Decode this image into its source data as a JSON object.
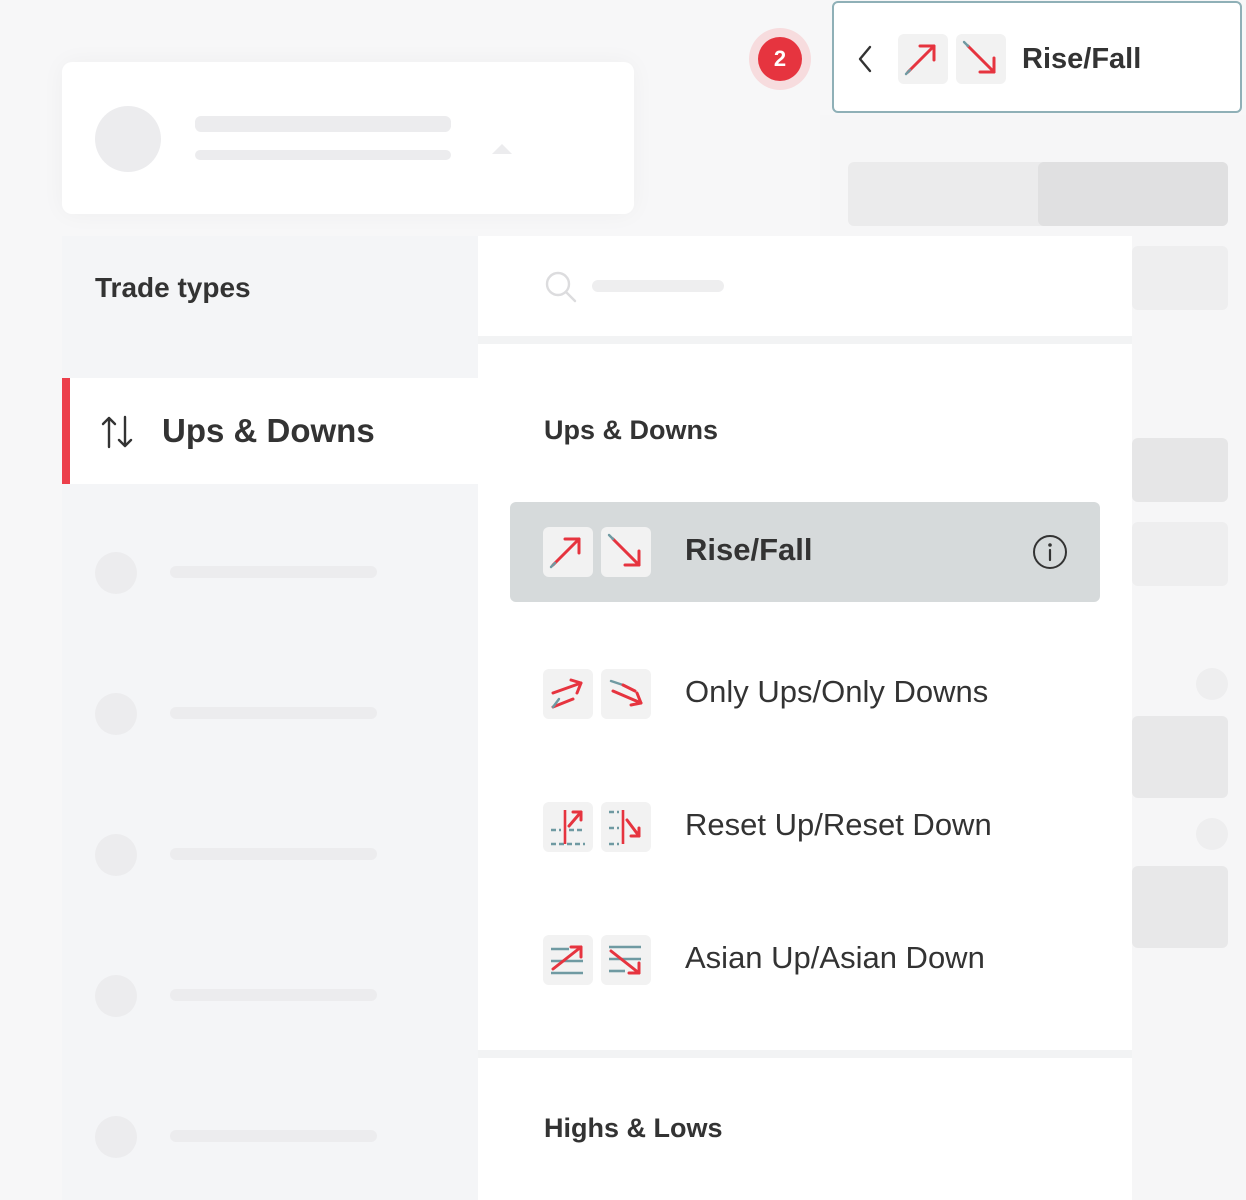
{
  "header": {
    "step_badge": "2",
    "selected_contract": "Rise/Fall"
  },
  "trade_types": {
    "title": "Trade types",
    "categories": [
      {
        "label": "Ups & Downs",
        "active": true
      }
    ]
  },
  "contracts_panel": {
    "sections": [
      {
        "title": "Ups & Downs",
        "items": [
          {
            "label": "Rise/Fall",
            "icons": [
              "rise-icon",
              "fall-icon"
            ],
            "selected": true
          },
          {
            "label": "Only Ups/Only Downs",
            "icons": [
              "only-ups-icon",
              "only-downs-icon"
            ],
            "selected": false
          },
          {
            "label": "Reset Up/Reset Down",
            "icons": [
              "reset-up-icon",
              "reset-down-icon"
            ],
            "selected": false
          },
          {
            "label": "Asian Up/Asian Down",
            "icons": [
              "asian-up-icon",
              "asian-down-icon"
            ],
            "selected": false
          }
        ]
      },
      {
        "title": "Highs & Lows",
        "items": []
      }
    ]
  },
  "colors": {
    "accent_red": "#ec3f4b",
    "badge_red": "#e6343f",
    "selected_row": "#d6dadb",
    "selector_border": "#8fb0b7"
  }
}
